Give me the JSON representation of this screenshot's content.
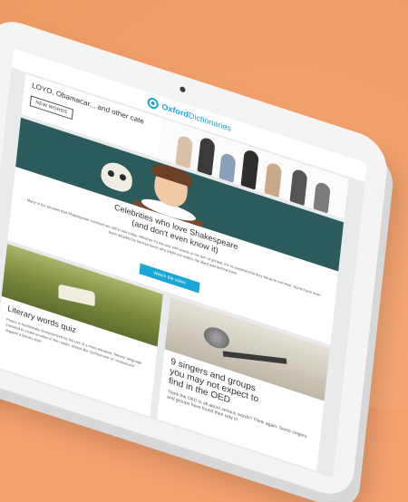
{
  "header": {
    "logo_bold": "Oxford",
    "logo_light": "Dictionaries"
  },
  "top_promo": {
    "title": "LOYO, Obamacar... and other cate",
    "button": "NEW WORDS"
  },
  "hero": {
    "title_line1": "Celebrities who love Shakespeare",
    "title_line2": "(and don't even know it)",
    "body": "Many of the phrases that Shakespeare invented are still in use today. Whether it's his way with words or his turn of phrase, it's no surprise that they became common. Some have even been adopted by famous faces who might not realize the Bard was behind them.",
    "button": "Watch the video"
  },
  "card_left": {
    "title": "Literary words quiz",
    "body": "Poetry is traditionally characterized by the use of a more elevated, 'literary' language intended to evoke emotion in the reader. Words like 'lachrymose' or 'crepuscular' suggest a literary style."
  },
  "card_right": {
    "title_line1": "9 singers and groups",
    "title_line2": "you may not expect to",
    "title_line3": "find in the OED",
    "body": "Think the OED is all about serious words? Think again. Some singers and groups have found their way in."
  },
  "colors": {
    "accent": "#1aa7d6",
    "background": "#f5a26f",
    "hero_bg": "#2b5b5d"
  }
}
